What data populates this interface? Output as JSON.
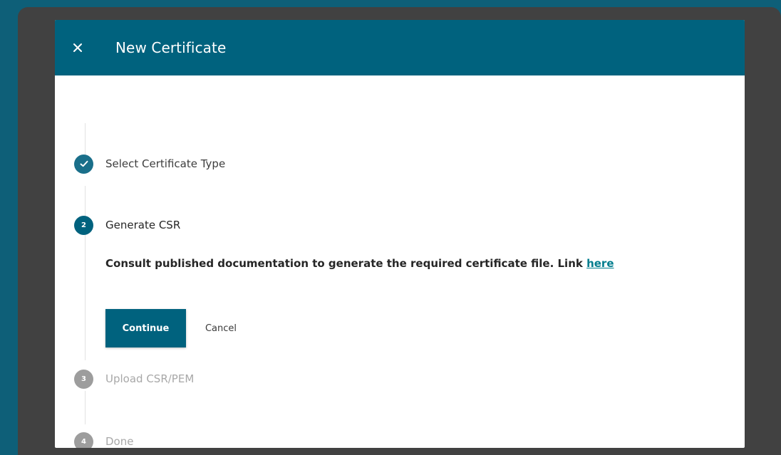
{
  "dialog": {
    "title": "New Certificate",
    "close_icon": "close-icon"
  },
  "steps": [
    {
      "number": "",
      "label": "Select Certificate Type",
      "state": "completed",
      "icon": "check-icon"
    },
    {
      "number": "2",
      "label": "Generate CSR",
      "state": "active"
    },
    {
      "number": "3",
      "label": "Upload CSR/PEM",
      "state": "inactive"
    },
    {
      "number": "4",
      "label": "Done",
      "state": "inactive"
    }
  ],
  "content": {
    "description": "Consult published documentation to generate the required certificate file. Link ",
    "link_text": "here"
  },
  "actions": {
    "continue_label": "Continue",
    "cancel_label": "Cancel"
  },
  "colors": {
    "page_background": "#0e5f78",
    "overlay": "#414141",
    "header": "#00627e",
    "primary": "#00627e",
    "link": "#007d8e",
    "inactive_step": "#9d9d9d"
  }
}
